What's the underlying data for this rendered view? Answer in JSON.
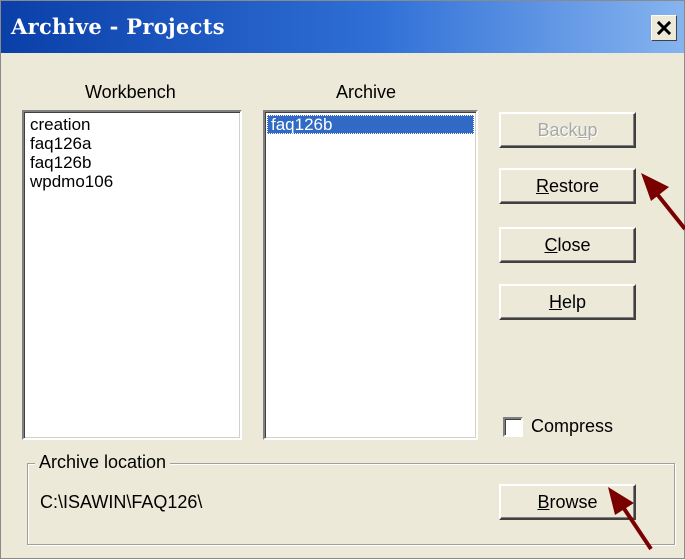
{
  "window": {
    "title": "Archive - Projects",
    "close_glyph": "✕"
  },
  "workbench": {
    "label": "Workbench",
    "items": [
      "creation",
      "faq126a",
      "faq126b",
      "wpdmo106"
    ]
  },
  "archive": {
    "label": "Archive",
    "items": [
      "faq126b"
    ],
    "selected": "faq126b"
  },
  "buttons": {
    "backup": {
      "label": "Backup",
      "before": "Back",
      "mnemonic": "u",
      "after": "p",
      "enabled": false
    },
    "restore": {
      "label": "Restore",
      "before": "",
      "mnemonic": "R",
      "after": "estore",
      "enabled": true
    },
    "close": {
      "label": "Close",
      "before": "",
      "mnemonic": "C",
      "after": "lose",
      "enabled": true
    },
    "help": {
      "label": "Help",
      "before": "",
      "mnemonic": "H",
      "after": "elp",
      "enabled": true
    },
    "browse": {
      "label": "Browse",
      "before": "",
      "mnemonic": "B",
      "after": "rowse",
      "enabled": true
    }
  },
  "compress": {
    "label": "Compress",
    "checked": false
  },
  "location": {
    "group_label": "Archive location",
    "path": "C:\\ISAWIN\\FAQ126\\"
  },
  "colors": {
    "titlebar_start": "#0a3fa8",
    "selection": "#316ac5",
    "annotation_arrow": "#7a0000",
    "dialog_face": "#ece9d8"
  },
  "icons": [
    "close-icon",
    "pointer-arrow-icon"
  ]
}
